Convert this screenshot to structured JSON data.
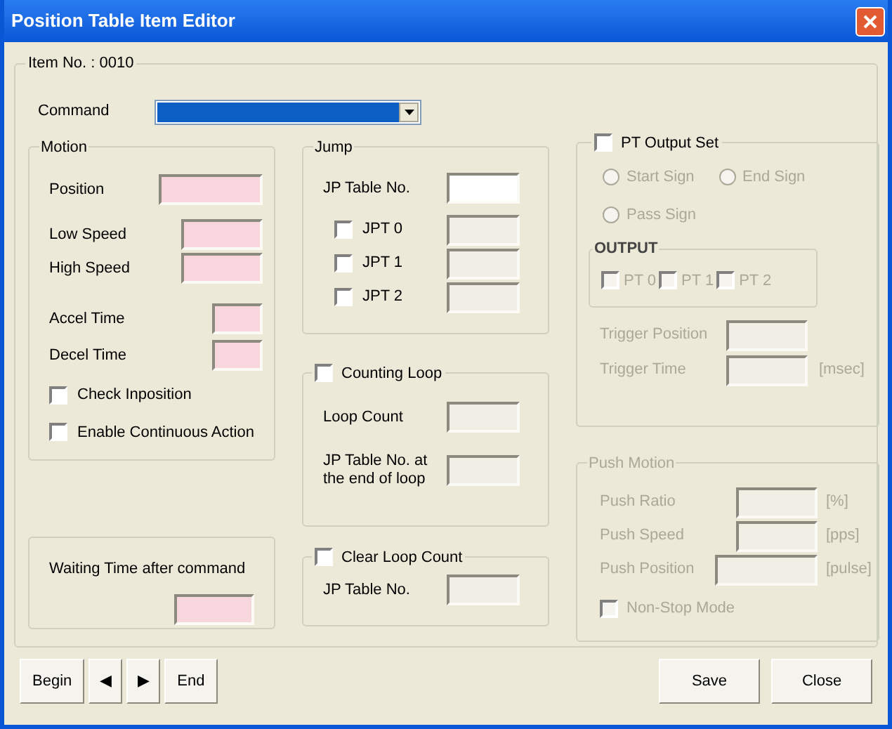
{
  "window": {
    "title": "Position Table Item Editor"
  },
  "item_group": {
    "label": "Item No. : 0010"
  },
  "command": {
    "label": "Command",
    "focused": true
  },
  "motion": {
    "title": "Motion",
    "fields": [
      {
        "label": "Position",
        "kind": "required"
      },
      {
        "label": "Low Speed",
        "kind": "required"
      },
      {
        "label": "High Speed",
        "kind": "required"
      },
      {
        "label": "Accel Time",
        "kind": "required"
      },
      {
        "label": "Decel Time",
        "kind": "required"
      }
    ],
    "checkboxes": [
      {
        "label": "Check Inposition",
        "checked": false
      },
      {
        "label": "Enable Continuous Action",
        "checked": false
      }
    ]
  },
  "waiting": {
    "label": "Waiting Time after command",
    "kind": "required"
  },
  "jump": {
    "title": "Jump",
    "table_field": {
      "label": "JP Table No.",
      "kind": "normal"
    },
    "items": [
      {
        "label": "JPT 0",
        "checked": false,
        "kind": "disabled"
      },
      {
        "label": "JPT 1",
        "checked": false,
        "kind": "disabled"
      },
      {
        "label": "JPT 2",
        "checked": false,
        "kind": "disabled"
      }
    ]
  },
  "counting_loop": {
    "label": "Counting Loop",
    "checked": false,
    "fields": [
      {
        "label": "Loop Count",
        "kind": "disabled"
      },
      {
        "label": "JP Table No. at the end of loop",
        "kind": "disabled"
      }
    ]
  },
  "clear_loop": {
    "label": "Clear Loop Count",
    "checked": false,
    "fields": [
      {
        "label": "JP Table No.",
        "kind": "disabled"
      }
    ]
  },
  "pt_output": {
    "label": "PT Output Set",
    "checked": false,
    "disabled": true,
    "radios": [
      {
        "label": "Start Sign",
        "selected": false
      },
      {
        "label": "End Sign",
        "selected": false
      },
      {
        "label": "Pass Sign",
        "selected": false
      }
    ],
    "output": {
      "title": "OUTPUT",
      "checkboxes": [
        {
          "label": "PT 0",
          "checked": false
        },
        {
          "label": "PT 1",
          "checked": false
        },
        {
          "label": "PT 2",
          "checked": false
        }
      ]
    },
    "fields": [
      {
        "label": "Trigger Position",
        "kind": "disabled"
      },
      {
        "label": "Trigger Time",
        "kind": "disabled",
        "unit": "[msec]"
      }
    ]
  },
  "push_motion": {
    "title": "Push Motion",
    "disabled": true,
    "fields": [
      {
        "label": "Push Ratio",
        "kind": "disabled",
        "unit": "[%]"
      },
      {
        "label": "Push Speed",
        "kind": "disabled",
        "unit": "[pps]"
      },
      {
        "label": "Push Position",
        "kind": "disabled",
        "unit": "[pulse]"
      }
    ],
    "checkbox": {
      "label": "Non-Stop Mode",
      "checked": false
    }
  },
  "nav_buttons": [
    "Begin",
    "◀",
    "▶",
    "End"
  ],
  "buttons": [
    "Save",
    "Close"
  ]
}
